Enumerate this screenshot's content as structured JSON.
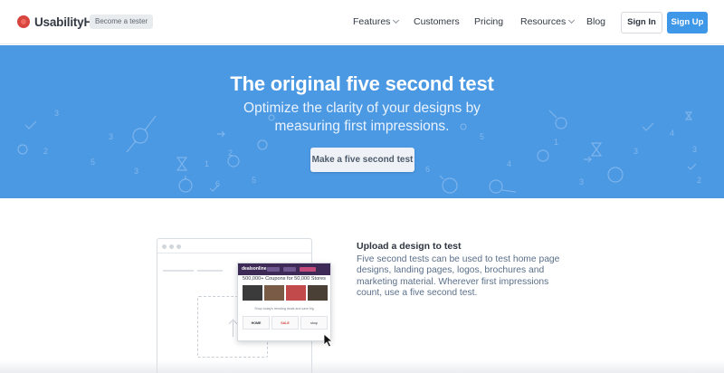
{
  "nav": {
    "brand": "UsabilityHub",
    "tester_badge": "Become a tester",
    "links": [
      {
        "label": "Features",
        "dropdown": true
      },
      {
        "label": "Customers",
        "dropdown": false
      },
      {
        "label": "Pricing",
        "dropdown": false
      },
      {
        "label": "Resources",
        "dropdown": true
      },
      {
        "label": "Blog",
        "dropdown": false
      }
    ],
    "signin_label": "Sign In",
    "signup_label": "Sign Up"
  },
  "hero": {
    "title": "The original five second test",
    "subtitle": "Optimize the clarity of your designs by measuring first impressions.",
    "cta_label": "Make a five second test",
    "background_color": "#4b98e3"
  },
  "feature": {
    "title": "Upload a design to test",
    "description": "Five second tests can be used to test home page designs, landing pages, logos, brochures and marketing material. Wherever first impressions count, use a five second test."
  },
  "mock_screenshot": {
    "site_logo": "dealsonline",
    "banner": "500,000+ Coupons for 50,000 Stores",
    "small_text": "Shop today's trending deals and save big",
    "cards": [
      "HOME",
      "SALE",
      "shop"
    ]
  },
  "colors": {
    "accent": "#3f97e8",
    "brand": "#d8453e"
  }
}
